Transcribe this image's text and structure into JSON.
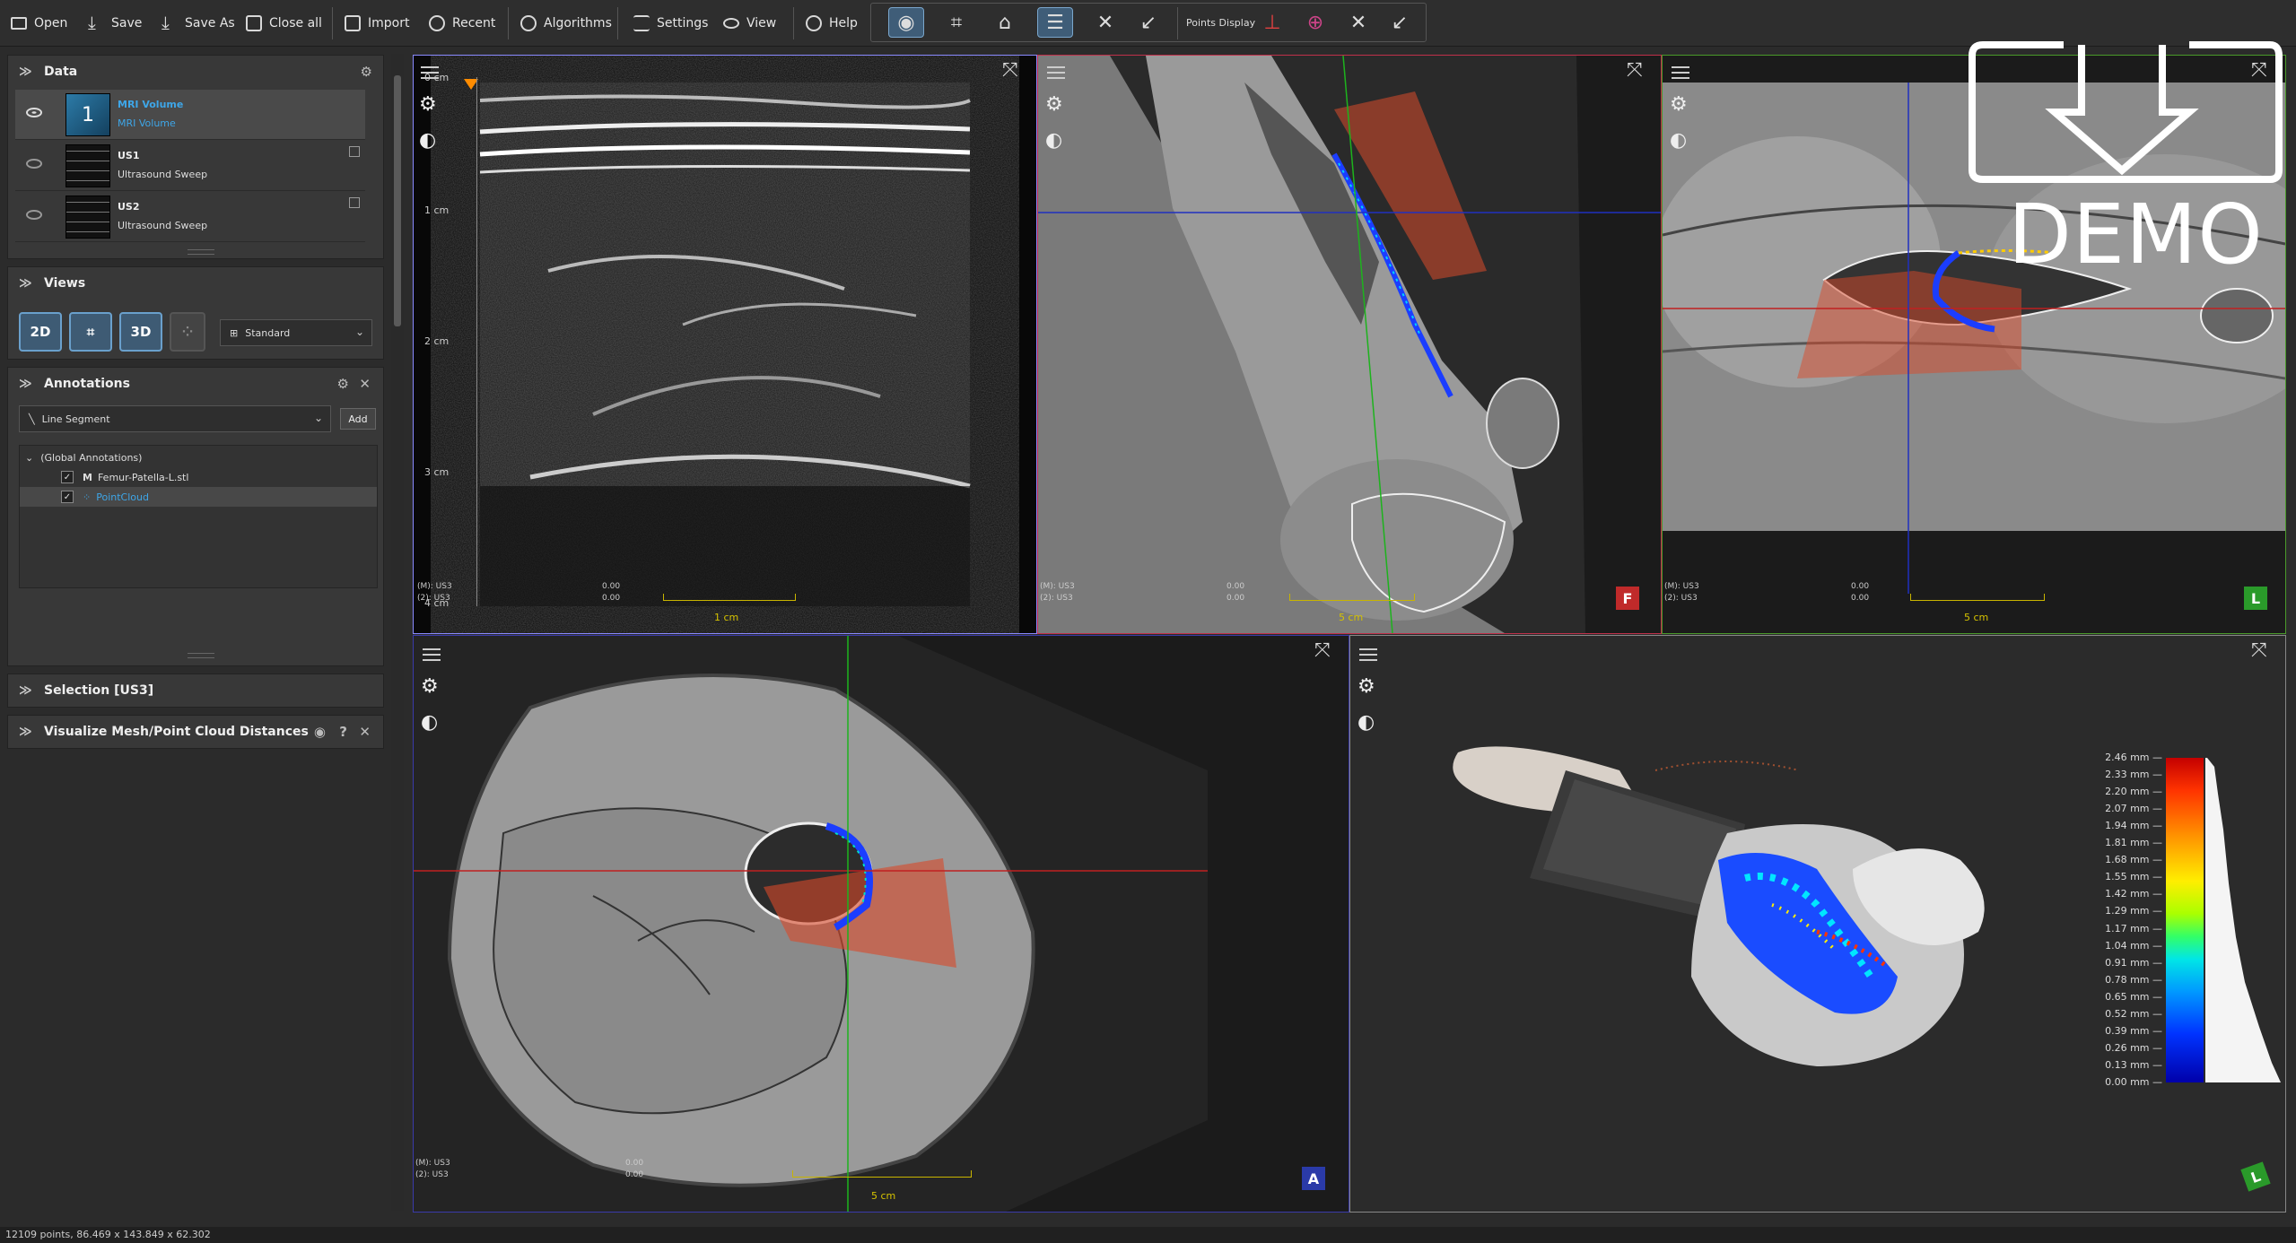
{
  "toolbar": {
    "open": "Open",
    "save": "Save",
    "save_as": "Save As",
    "close_all": "Close all",
    "import": "Import",
    "recent": "Recent",
    "algorithms": "Algorithms",
    "settings": "Settings",
    "view": "View",
    "help": "Help",
    "points_display": "Points Display"
  },
  "data_panel": {
    "title": "Data",
    "items": [
      {
        "name": "MRI Volume",
        "sub": "MRI Volume",
        "thumb": "1"
      },
      {
        "name": "US1",
        "sub": "Ultrasound Sweep"
      },
      {
        "name": "US2",
        "sub": "Ultrasound Sweep"
      }
    ]
  },
  "views_panel": {
    "title": "Views",
    "btn_2d": "2D",
    "btn_3d": "3D",
    "layout": "Standard"
  },
  "annotations_panel": {
    "title": "Annotations",
    "tool": "Line Segment",
    "add": "Add",
    "tree": [
      "(Global Annotations)",
      "Femur-Patella-L.stl",
      "PointCloud"
    ]
  },
  "selection_panel": {
    "title": "Selection [US3]"
  },
  "distance_panel": {
    "title": "Visualize Mesh/Point Cloud Distances"
  },
  "views": {
    "us": {
      "ruler": [
        "0 cm",
        "1 cm",
        "2 cm",
        "3 cm",
        "4 cm"
      ],
      "info_m": "(M): US3",
      "info_2": "(2): US3",
      "v1": "0.00",
      "v2": "0.00",
      "scale": "1 cm"
    },
    "sagittal": {
      "info_m": "(M): US3",
      "info_2": "(2): US3",
      "v1": "0.00",
      "v2": "0.00",
      "scale": "5 cm",
      "orient": "F"
    },
    "coronal": {
      "info_m": "(M): US3",
      "info_2": "(2): US3",
      "v1": "0.00",
      "v2": "0.00",
      "scale": "5 cm",
      "orient": "L"
    },
    "axial": {
      "info_m": "(M): US3",
      "info_2": "(2): US3",
      "v1": "0.00",
      "v2": "0.00",
      "scale": "5 cm",
      "orient": "A"
    },
    "render3d": {
      "orient": "L"
    }
  },
  "colorbar": {
    "labels": [
      "2.46 mm",
      "2.33 mm",
      "2.20 mm",
      "2.07 mm",
      "1.94 mm",
      "1.81 mm",
      "1.68 mm",
      "1.55 mm",
      "1.42 mm",
      "1.29 mm",
      "1.17 mm",
      "1.04 mm",
      "0.91 mm",
      "0.78 mm",
      "0.65 mm",
      "0.52 mm",
      "0.39 mm",
      "0.26 mm",
      "0.13 mm",
      "0.00 mm"
    ]
  },
  "watermark": "DEMO",
  "status": "12109 points, 86.469 x 143.849 x 62.302",
  "colors": {
    "accent": "#3ea6e8",
    "sagittal_border": "#c0304a",
    "coronal_border": "#4a9a2a",
    "axial_border": "#3a3aaa",
    "us_border": "#8a8aff",
    "scale": "#c8b400"
  }
}
